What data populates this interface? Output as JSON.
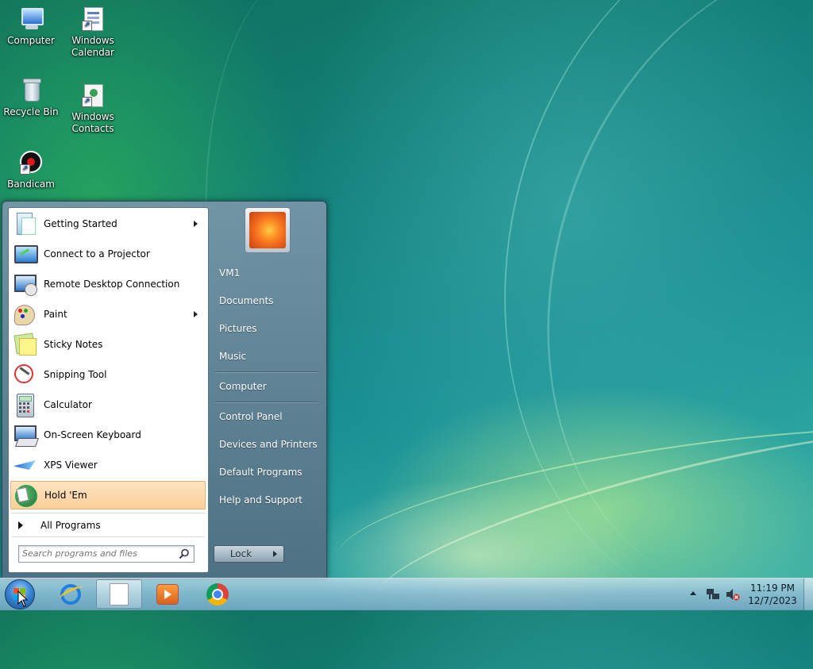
{
  "desktop": {
    "icons": [
      {
        "label": "Computer",
        "icon": "computer-icon"
      },
      {
        "label": "Windows Calendar",
        "icon": "calendar-icon"
      },
      {
        "label": "Recycle Bin",
        "icon": "recycle-bin-icon"
      },
      {
        "label": "Windows Contacts",
        "icon": "contacts-icon"
      },
      {
        "label": "Bandicam",
        "icon": "bandicam-icon"
      }
    ]
  },
  "start_menu": {
    "programs": [
      {
        "label": "Getting Started",
        "icon": "getting-started-icon",
        "has_submenu": true
      },
      {
        "label": "Connect to a Projector",
        "icon": "projector-icon",
        "has_submenu": false
      },
      {
        "label": "Remote Desktop Connection",
        "icon": "remote-desktop-icon",
        "has_submenu": false
      },
      {
        "label": "Paint",
        "icon": "paint-icon",
        "has_submenu": true
      },
      {
        "label": "Sticky Notes",
        "icon": "sticky-notes-icon",
        "has_submenu": false
      },
      {
        "label": "Snipping Tool",
        "icon": "snipping-tool-icon",
        "has_submenu": false
      },
      {
        "label": "Calculator",
        "icon": "calculator-icon",
        "has_submenu": false
      },
      {
        "label": "On-Screen Keyboard",
        "icon": "keyboard-icon",
        "has_submenu": false
      },
      {
        "label": "XPS Viewer",
        "icon": "xps-viewer-icon",
        "has_submenu": false
      },
      {
        "label": "Hold 'Em",
        "icon": "hold-em-icon",
        "has_submenu": false,
        "highlighted": true
      }
    ],
    "all_programs_label": "All Programs",
    "search_placeholder": "Search programs and files",
    "right_items": [
      {
        "label": "VM1"
      },
      {
        "label": "Documents"
      },
      {
        "label": "Pictures"
      },
      {
        "label": "Music"
      },
      {
        "label": "Computer"
      },
      {
        "label": "Control Panel"
      },
      {
        "label": "Devices and Printers"
      },
      {
        "label": "Default Programs"
      },
      {
        "label": "Help and Support"
      }
    ],
    "lock_label": "Lock"
  },
  "taskbar": {
    "pinned": [
      {
        "name": "internet-explorer",
        "icon": "internet-explorer-icon"
      },
      {
        "name": "notepad",
        "icon": "notepad-icon",
        "active": true
      },
      {
        "name": "media-player",
        "icon": "media-player-icon"
      },
      {
        "name": "chrome",
        "icon": "chrome-icon"
      }
    ],
    "clock": {
      "time": "11:19 PM",
      "date": "12/7/2023"
    }
  },
  "colors": {
    "highlight": "#fbcf9a",
    "taskbar": "#9fc3da",
    "wallpaper_primary": "#13807a"
  }
}
